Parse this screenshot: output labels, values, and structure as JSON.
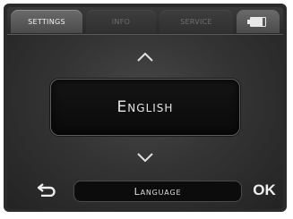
{
  "tabs": [
    {
      "label": "Settings"
    },
    {
      "label": "Info"
    },
    {
      "label": "Service"
    }
  ],
  "battery": {
    "icon": "battery-icon"
  },
  "selector": {
    "up_icon": "chevron-up-icon",
    "value": "English",
    "down_icon": "chevron-down-icon"
  },
  "bottom_bar": {
    "back_icon": "back-arrow-icon",
    "label": "Language",
    "ok_label": "OK"
  }
}
